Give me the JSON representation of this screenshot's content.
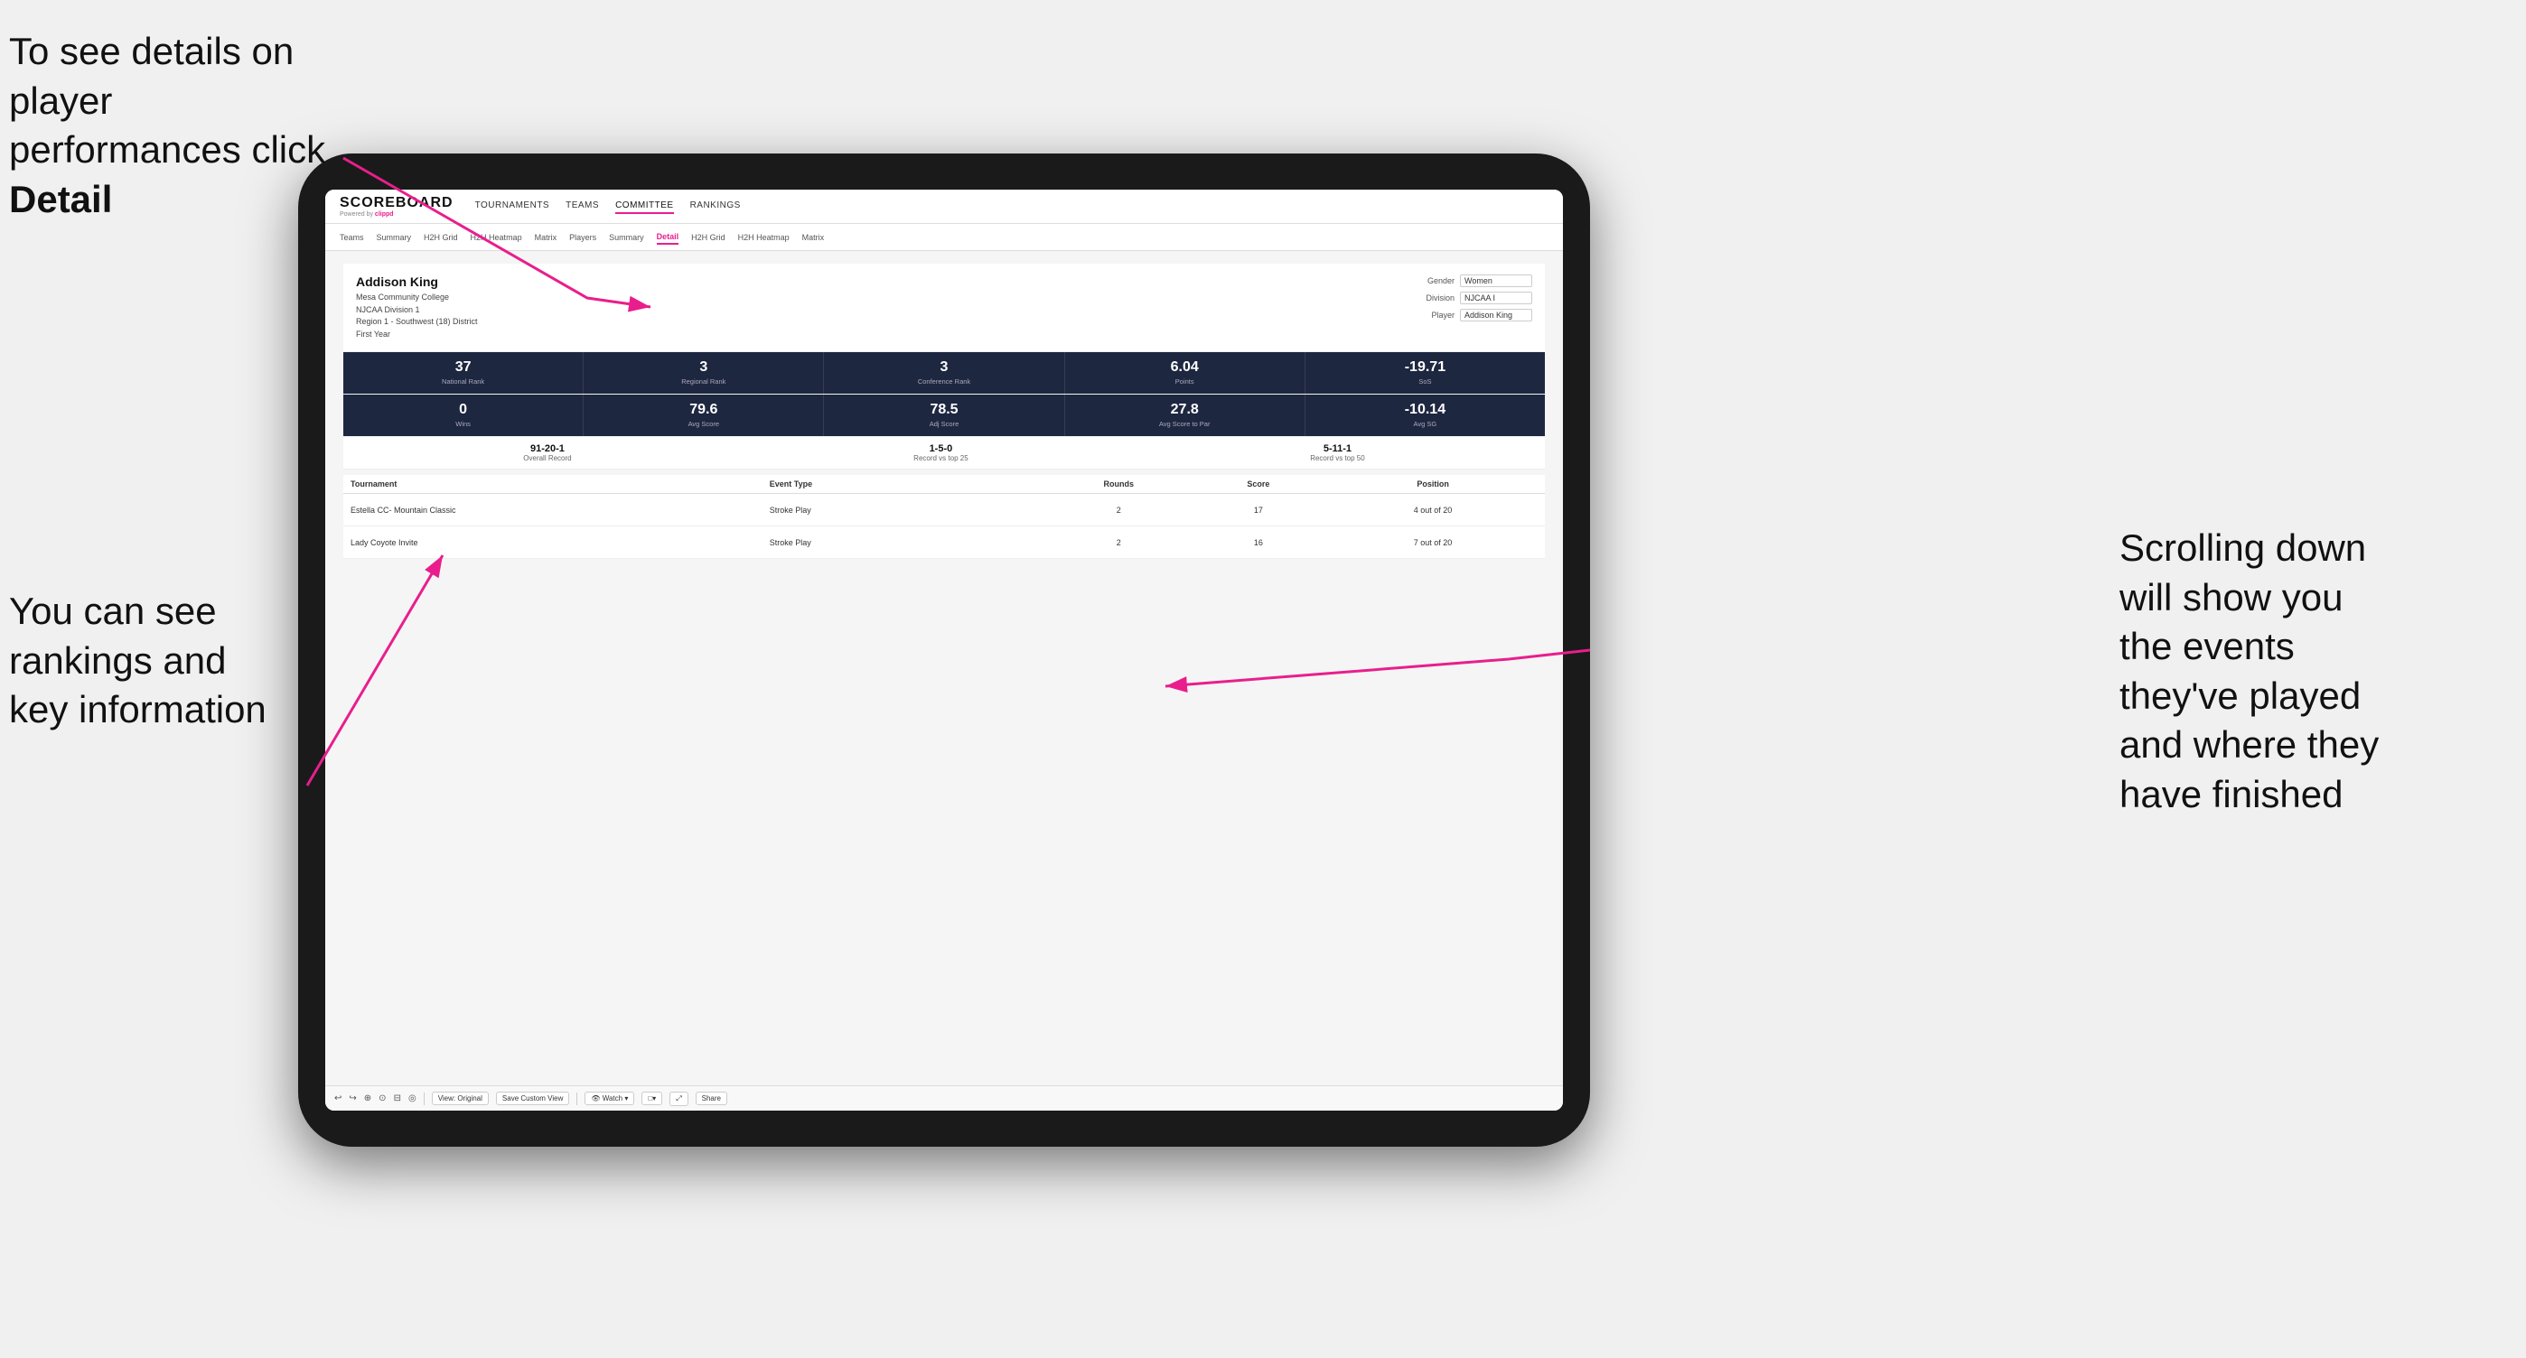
{
  "annotations": {
    "top_left": "To see details on player performances click ",
    "top_left_bold": "Detail",
    "bottom_left_line1": "You can see",
    "bottom_left_line2": "rankings and",
    "bottom_left_line3": "key information",
    "right_line1": "Scrolling down",
    "right_line2": "will show you",
    "right_line3": "the events",
    "right_line4": "they've played",
    "right_line5": "and where they",
    "right_line6": "have finished"
  },
  "app": {
    "logo": "SCOREBOARD",
    "powered_by": "Powered by",
    "clippd": "clippd",
    "nav": {
      "items": [
        "TOURNAMENTS",
        "TEAMS",
        "COMMITTEE",
        "RANKINGS"
      ]
    },
    "sub_nav": {
      "items": [
        "Teams",
        "Summary",
        "H2H Grid",
        "H2H Heatmap",
        "Matrix",
        "Players",
        "Summary",
        "Detail",
        "H2H Grid",
        "H2H Heatmap",
        "Matrix"
      ],
      "active": "Detail"
    },
    "player": {
      "name": "Addison King",
      "college": "Mesa Community College",
      "division": "NJCAA Division 1",
      "region": "Region 1 - Southwest (18) District",
      "year": "First Year"
    },
    "selectors": {
      "gender_label": "Gender",
      "gender_value": "Women",
      "division_label": "Division",
      "division_value": "NJCAA I",
      "player_label": "Player",
      "player_value": "Addison King"
    },
    "stats_row1": [
      {
        "value": "37",
        "label": "National Rank"
      },
      {
        "value": "3",
        "label": "Regional Rank"
      },
      {
        "value": "3",
        "label": "Conference Rank"
      },
      {
        "value": "6.04",
        "label": "Points"
      },
      {
        "value": "-19.71",
        "label": "SoS"
      }
    ],
    "stats_row2": [
      {
        "value": "0",
        "label": "Wins"
      },
      {
        "value": "79.6",
        "label": "Avg Score"
      },
      {
        "value": "78.5",
        "label": "Adj Score"
      },
      {
        "value": "27.8",
        "label": "Avg Score to Par"
      },
      {
        "value": "-10.14",
        "label": "Avg SG"
      }
    ],
    "records": [
      {
        "value": "91-20-1",
        "label": "Overall Record"
      },
      {
        "value": "1-5-0",
        "label": "Record vs top 25"
      },
      {
        "value": "5-11-1",
        "label": "Record vs top 50"
      }
    ],
    "table": {
      "headers": [
        "Tournament",
        "Event Type",
        "Rounds",
        "Score",
        "Position"
      ],
      "rows": [
        {
          "tournament": "Estella CC- Mountain Classic",
          "event_type": "Stroke Play",
          "rounds": "2",
          "score": "17",
          "position": "4 out of 20"
        },
        {
          "tournament": "Lady Coyote Invite",
          "event_type": "Stroke Play",
          "rounds": "2",
          "score": "16",
          "position": "7 out of 20"
        }
      ]
    },
    "toolbar": {
      "items": [
        "↩",
        "↪",
        "⊕",
        "⊙",
        "⊟",
        "◎",
        "View: Original",
        "Save Custom View",
        "👁 Watch ▾",
        "□▾",
        "⤢",
        "Share"
      ]
    }
  }
}
